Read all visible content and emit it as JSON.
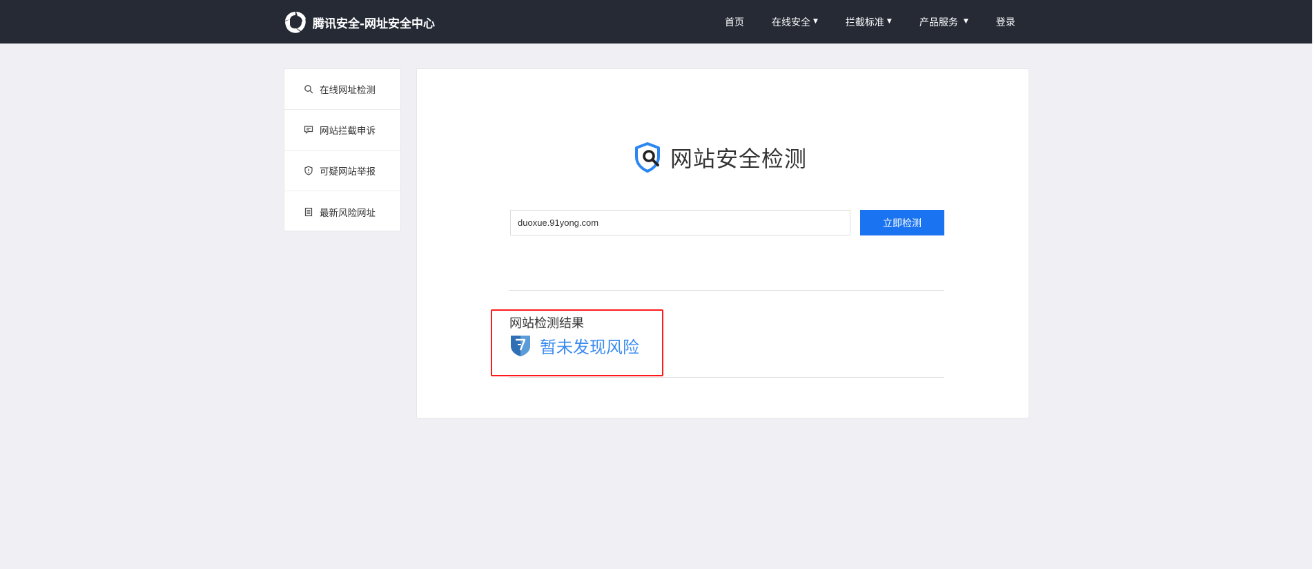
{
  "header": {
    "brand": "腾讯安全-网址安全中心",
    "nav": [
      {
        "label": "首页",
        "has_caret": false
      },
      {
        "label": "在线安全",
        "has_caret": true
      },
      {
        "label": "拦截标准",
        "has_caret": true
      },
      {
        "label": "产品服务",
        "has_caret": true
      },
      {
        "label": "登录",
        "has_caret": false
      }
    ]
  },
  "sidebar": {
    "items": [
      {
        "label": "在线网址检测",
        "icon": "search-icon"
      },
      {
        "label": "网站拦截申诉",
        "icon": "comment-icon"
      },
      {
        "label": "可疑网站举报",
        "icon": "shield-alert-icon"
      },
      {
        "label": "最新风险网址",
        "icon": "document-list-icon"
      }
    ]
  },
  "main": {
    "title": "网站安全检测",
    "search": {
      "value": "duoxue.91yong.com",
      "button_label": "立即检测"
    },
    "result": {
      "label": "网站检测结果",
      "status": "暂未发现风险"
    }
  },
  "colors": {
    "topbar": "#252a35",
    "accent": "#1a73f0",
    "result_text": "#3c8cf0",
    "highlight_box": "#ff1a1a"
  }
}
